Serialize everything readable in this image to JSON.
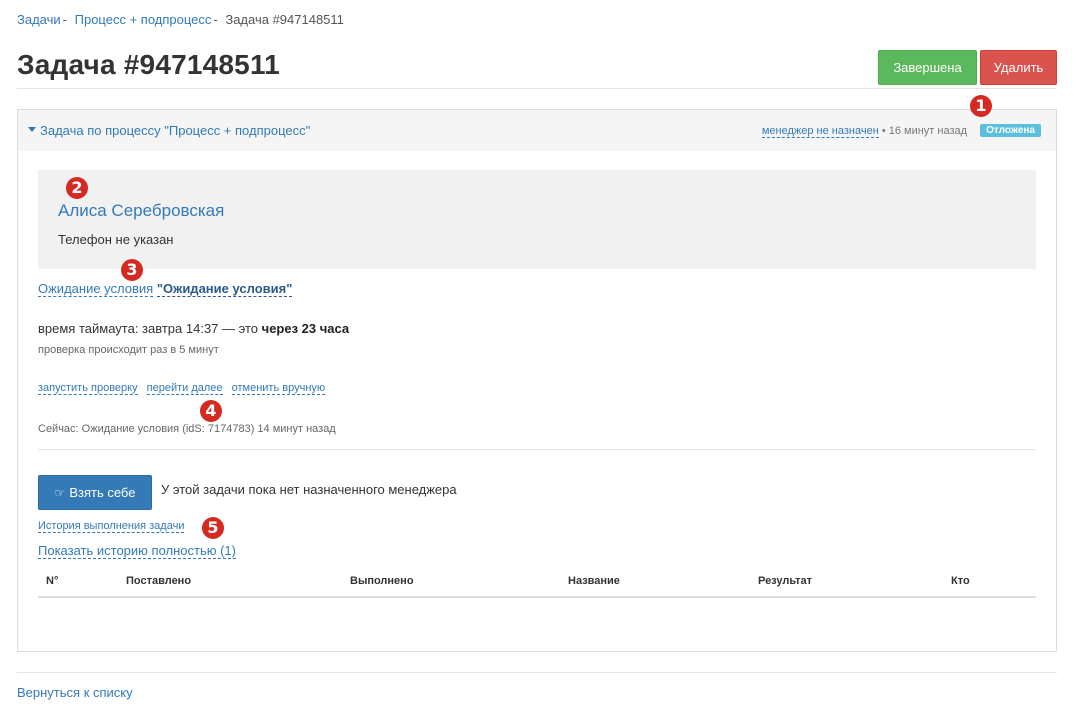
{
  "breadcrumb": {
    "items": [
      "Задачи",
      "Процесс + подпроцесс"
    ],
    "separator": "-",
    "current": "Задача #947148511"
  },
  "page": {
    "title": "Задача #947148511"
  },
  "toolbar": {
    "done_label": "Завершена",
    "delete_label": "Удалить"
  },
  "panel": {
    "title": "Задача по процессу \"Процесс + подпроцесс\"",
    "manager_link": "менеджер не назначен",
    "time_ago": "• 16 минут назад",
    "status_badge": "Отложена"
  },
  "contact": {
    "name": "Алиса Серебровская",
    "phone": "Телефон не указан"
  },
  "wait": {
    "label": "Ожидание условия",
    "name": "\"Ожидание условия\""
  },
  "timeout": {
    "prefix": "время таймаута: завтра 14:37 — это",
    "highlight": "через 23 часа",
    "check_note": "проверка происходит раз в 5 минут"
  },
  "actions": {
    "run_check": "запустить проверку",
    "go_next": "перейти далее",
    "cancel_manual": "отменить вручную"
  },
  "now_line": "Сейчас: Ожидание условия (idS: 7174783) 14 минут назад",
  "take": {
    "button_label": "Взять себе",
    "no_manager_text": "У этой задачи пока нет назначенного менеджера"
  },
  "history": {
    "link": "История выполнения задачи",
    "full_link": "Показать историю полностью (1)",
    "columns": [
      "N°",
      "Поставлено",
      "Выполнено",
      "Название",
      "Результат",
      "Кто"
    ]
  },
  "markers": [
    "1",
    "2",
    "3",
    "4",
    "5"
  ],
  "footer": {
    "back_link": "Вернуться к списку"
  },
  "colors": {
    "success": "#5cb85c",
    "danger": "#d9534f",
    "primary": "#337ab7",
    "info_badge": "#5bc0de",
    "marker": "#d42a21"
  }
}
